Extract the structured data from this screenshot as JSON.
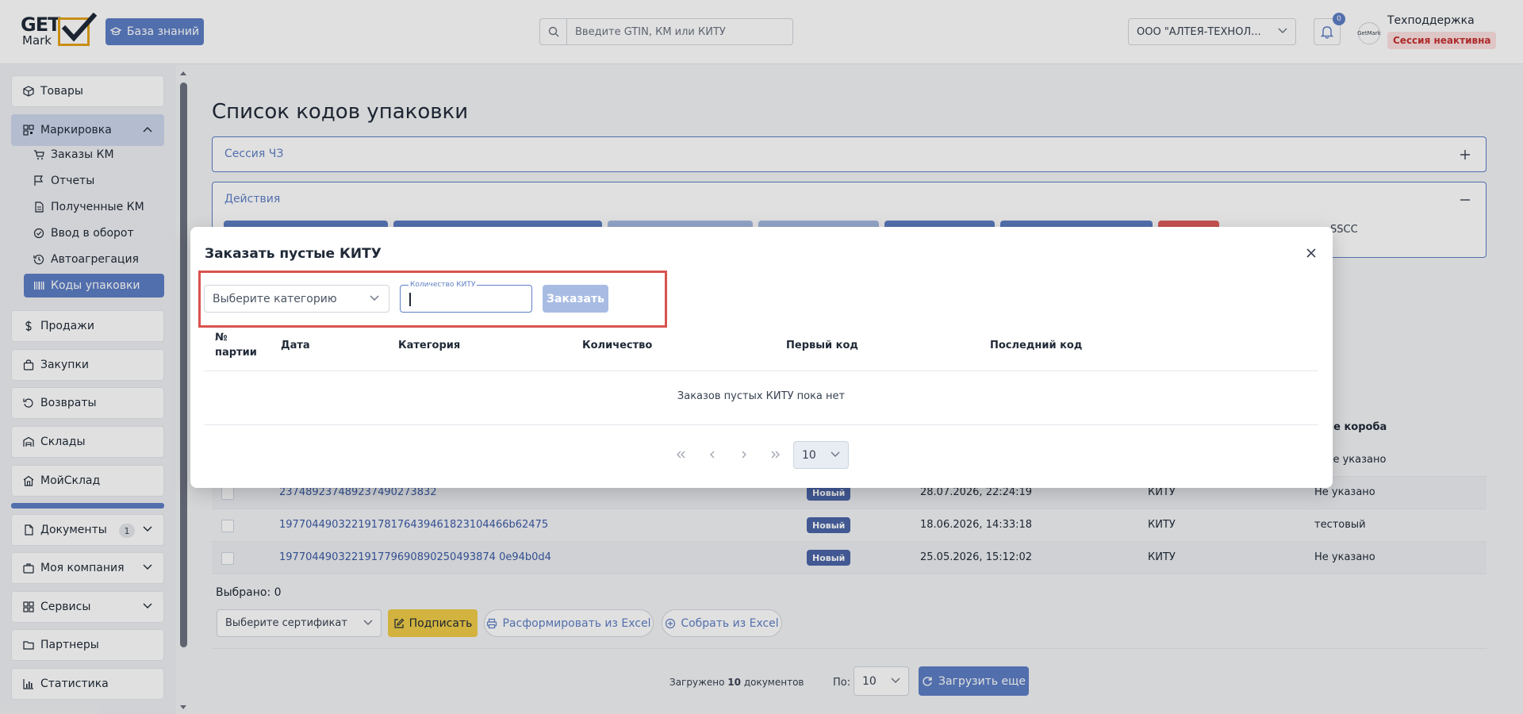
{
  "header": {
    "logo_top": "GET",
    "logo_bottom": "Mark",
    "knowledge_base_label": "База знаний",
    "search_placeholder": "Введите GTIN, КМ или КИТУ",
    "org_selected": "ООО \"АЛТЕЯ-ТЕХНОЛ...",
    "notifications_count": "0",
    "avatar_text": "GetMark",
    "user_name": "Техподдержка",
    "session_status": "Сессия неактивна"
  },
  "sidebar": {
    "items": [
      {
        "label": "Товары",
        "icon": "box-icon"
      },
      {
        "label": "Маркировка",
        "icon": "qr-icon"
      },
      {
        "label": "Продажи",
        "icon": "dollar-icon"
      },
      {
        "label": "Закупки",
        "icon": "bag-icon"
      },
      {
        "label": "Возвраты",
        "icon": "return-icon"
      },
      {
        "label": "Склады",
        "icon": "warehouse-icon"
      },
      {
        "label": "МойСклад",
        "icon": "store-icon"
      },
      {
        "label": "Документы",
        "icon": "document-icon",
        "count": "1"
      },
      {
        "label": "Моя компания",
        "icon": "briefcase-icon"
      },
      {
        "label": "Сервисы",
        "icon": "grid-icon"
      },
      {
        "label": "Партнеры",
        "icon": "folder-icon"
      },
      {
        "label": "Статистика",
        "icon": "chart-icon"
      }
    ],
    "sub_items": [
      {
        "label": "Заказы КМ",
        "icon": "cart-icon"
      },
      {
        "label": "Отчеты",
        "icon": "flag-icon"
      },
      {
        "label": "Полученные КМ",
        "icon": "file-icon"
      },
      {
        "label": "Ввод в оборот",
        "icon": "check-circle-icon"
      },
      {
        "label": "Автоагрегация",
        "icon": "history-icon"
      },
      {
        "label": "Коды упаковки",
        "icon": "barcode-icon"
      }
    ]
  },
  "main": {
    "page_title": "Список кодов упаковки",
    "session_panel_title": "Сессия ЧЗ",
    "actions_panel_title": "Действия",
    "sscc_text": "SSCC",
    "col_box_desc": "ие короба",
    "rows": [
      {
        "code": "",
        "status": "",
        "date": "",
        "type": "",
        "desc": "ие указано"
      },
      {
        "code": "237489237489237490273832",
        "status": "Новый",
        "date": "28.07.2026, 22:24:19",
        "type": "КИТУ",
        "desc": "Не указано"
      },
      {
        "code": "19770449032219178176439461823104466b62475",
        "status": "Новый",
        "date": "18.06.2026, 14:33:18",
        "type": "КИТУ",
        "desc": "тестовый"
      },
      {
        "code": "197704490322191779690890250493874 0e94b0d4",
        "status": "Новый",
        "date": "25.05.2026, 15:12:02",
        "type": "КИТУ",
        "desc": "Не указано"
      }
    ],
    "selected_text": "Выбрано: 0",
    "cert_placeholder": "Выберите сертификат",
    "sign_label": "Подписать",
    "disband_label": "Расформировать из Excel",
    "assemble_label": "Собрать из Excel",
    "loaded_prefix": "Загружено",
    "loaded_count": "10",
    "loaded_suffix": "документов",
    "per_page_label": "По:",
    "per_page_value": "10",
    "load_more_label": "Загрузить еще"
  },
  "modal": {
    "title": "Заказать пустые КИТУ",
    "category_placeholder": "Выберите категорию",
    "quantity_label": "Количество КИТУ",
    "quantity_value": "",
    "order_label": "Заказать",
    "columns": [
      "№ партии",
      "Дата",
      "Категория",
      "Количество",
      "Первый код",
      "Последний код"
    ],
    "empty_message": "Заказов пустых КИТУ пока нет",
    "page_size": "10"
  },
  "colors": {
    "accent": "#5e7fc5",
    "highlight": "#d9534f",
    "sign": "#f0cc48",
    "danger_badge": "#fde2e2"
  }
}
